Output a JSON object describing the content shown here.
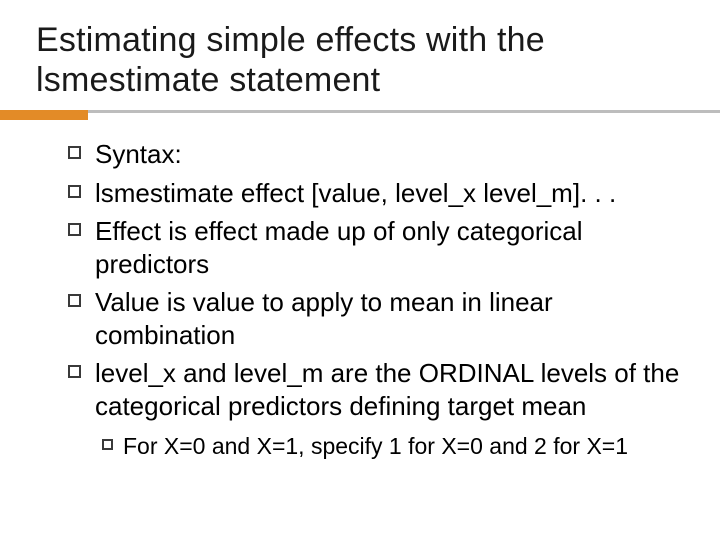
{
  "title": "Estimating simple effects with the lsmestimate statement",
  "bullets": [
    {
      "level": 1,
      "text": "Syntax:"
    },
    {
      "level": 1,
      "text": "lsmestimate effect [value, level_x level_m]. . ."
    },
    {
      "level": 1,
      "text": "Effect is effect made up of only categorical predictors"
    },
    {
      "level": 1,
      "text": "Value is value to apply to mean in linear combination"
    },
    {
      "level": 1,
      "text": "level_x and level_m are the ORDINAL levels of the categorical predictors defining target mean"
    },
    {
      "level": 2,
      "text": "For X=0 and X=1, specify 1 for X=0 and 2 for X=1"
    }
  ]
}
